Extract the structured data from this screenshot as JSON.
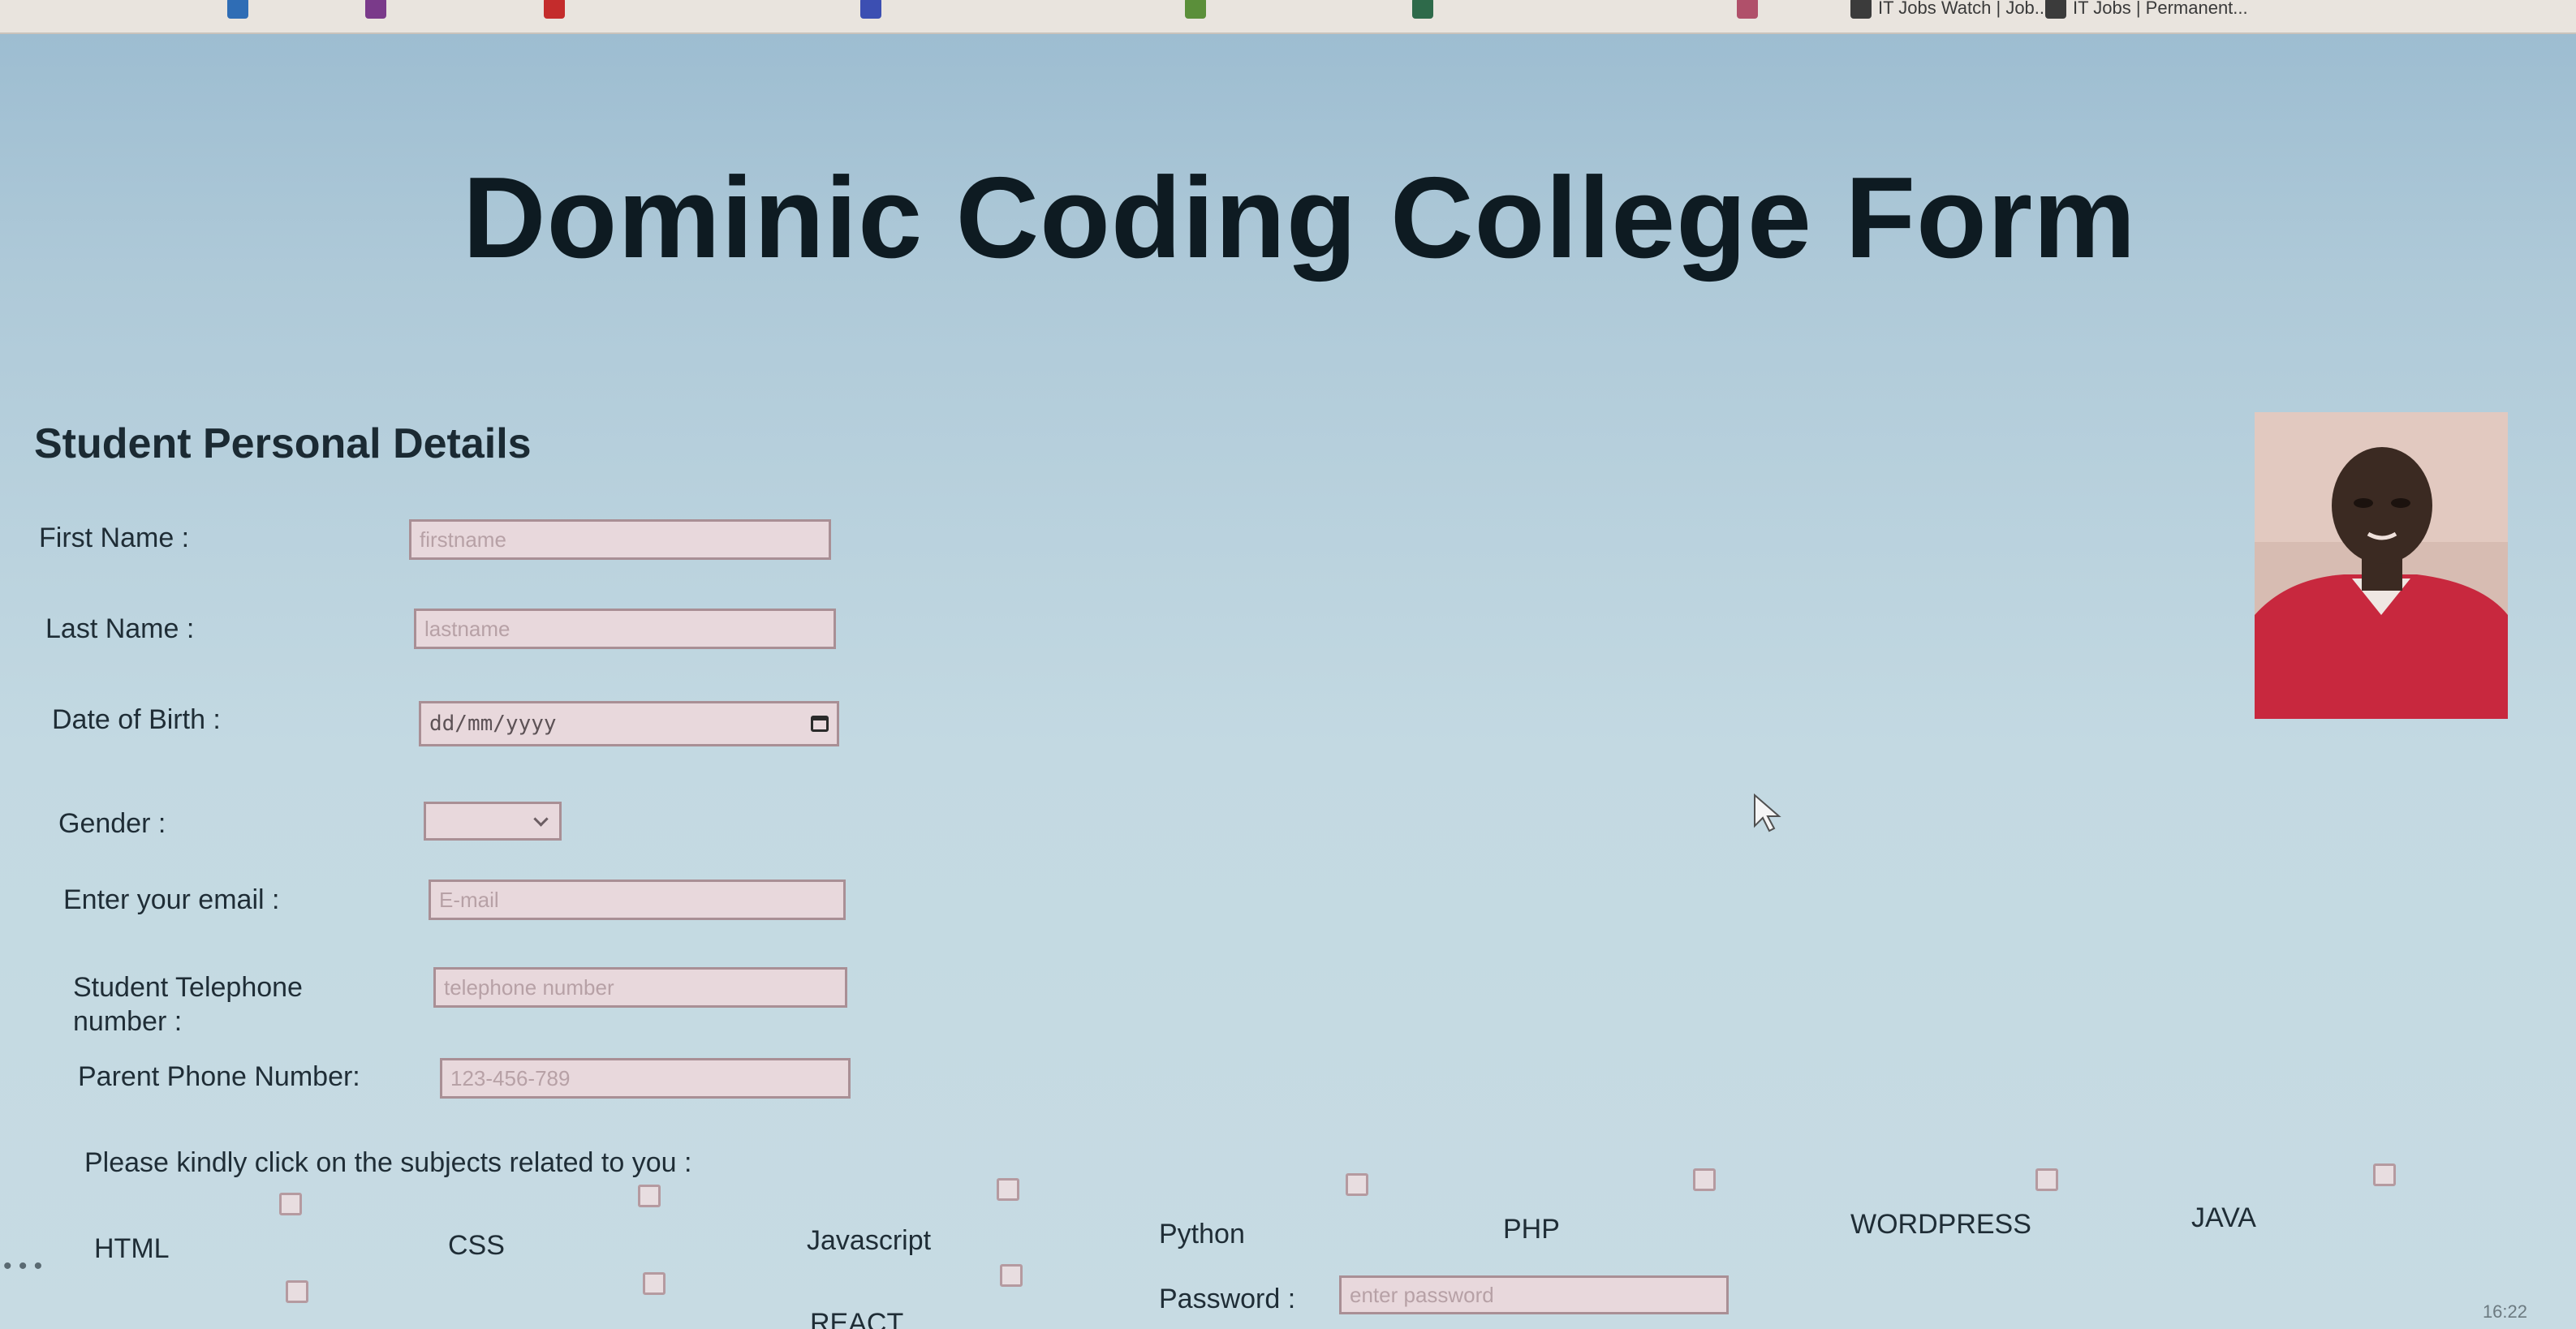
{
  "browser": {
    "bookmarks": [
      {
        "label": "",
        "icon": "bookmark-icon",
        "color": "#2f6db5"
      },
      {
        "label": "",
        "icon": "bookmark-icon",
        "color": "#7a3a8a"
      },
      {
        "label": "",
        "icon": "bookmark-icon",
        "color": "#c42c2c"
      },
      {
        "label": "",
        "icon": "bookmark-icon",
        "color": "#3c4fb2"
      },
      {
        "label": "",
        "icon": "bookmark-icon",
        "color": "#5b8f3a"
      },
      {
        "label": "",
        "icon": "bookmark-icon",
        "color": "#2e6a4a"
      },
      {
        "label": "",
        "icon": "bookmark-icon",
        "color": "#b0506a"
      },
      {
        "label": "IT Jobs Watch | Job...",
        "icon": "bookmark-icon",
        "color": "#3b3b3b"
      },
      {
        "label": "IT Jobs | Permanent...",
        "icon": "bookmark-icon",
        "color": "#3b3b3b"
      }
    ]
  },
  "page": {
    "title": "Dominic Coding College Form",
    "section_heading": "Student Personal Details"
  },
  "form": {
    "first_name": {
      "label": "First Name :",
      "placeholder": "firstname"
    },
    "last_name": {
      "label": "Last Name :",
      "placeholder": "lastname"
    },
    "dob": {
      "label": "Date of Birth :",
      "placeholder": "dd/mm/yyyy"
    },
    "gender": {
      "label": "Gender :",
      "value": ""
    },
    "email": {
      "label": "Enter your email :",
      "placeholder": "E-mail"
    },
    "student_phone": {
      "label_line1": "Student Telephone",
      "label_line2": "number :",
      "placeholder": "telephone number"
    },
    "parent_phone": {
      "label": "Parent Phone Number:",
      "placeholder": "123-456-789"
    },
    "subjects_prompt": "Please kindly click on the subjects related to you :",
    "subjects": [
      "HTML",
      "CSS",
      "Javascript",
      "Python",
      "PHP",
      "WORDPRESS",
      "JAVA"
    ],
    "subjects_row2": [
      "",
      "",
      "REACT"
    ],
    "password": {
      "label": "Password :",
      "placeholder": "enter password"
    }
  },
  "profile_photo": {
    "icon": "profile-photo",
    "colors": {
      "shirt": "#c8283e",
      "skin": "#3b2a22",
      "background": "#cdb2aa"
    }
  },
  "taskbar": {
    "clock": "16:22"
  }
}
